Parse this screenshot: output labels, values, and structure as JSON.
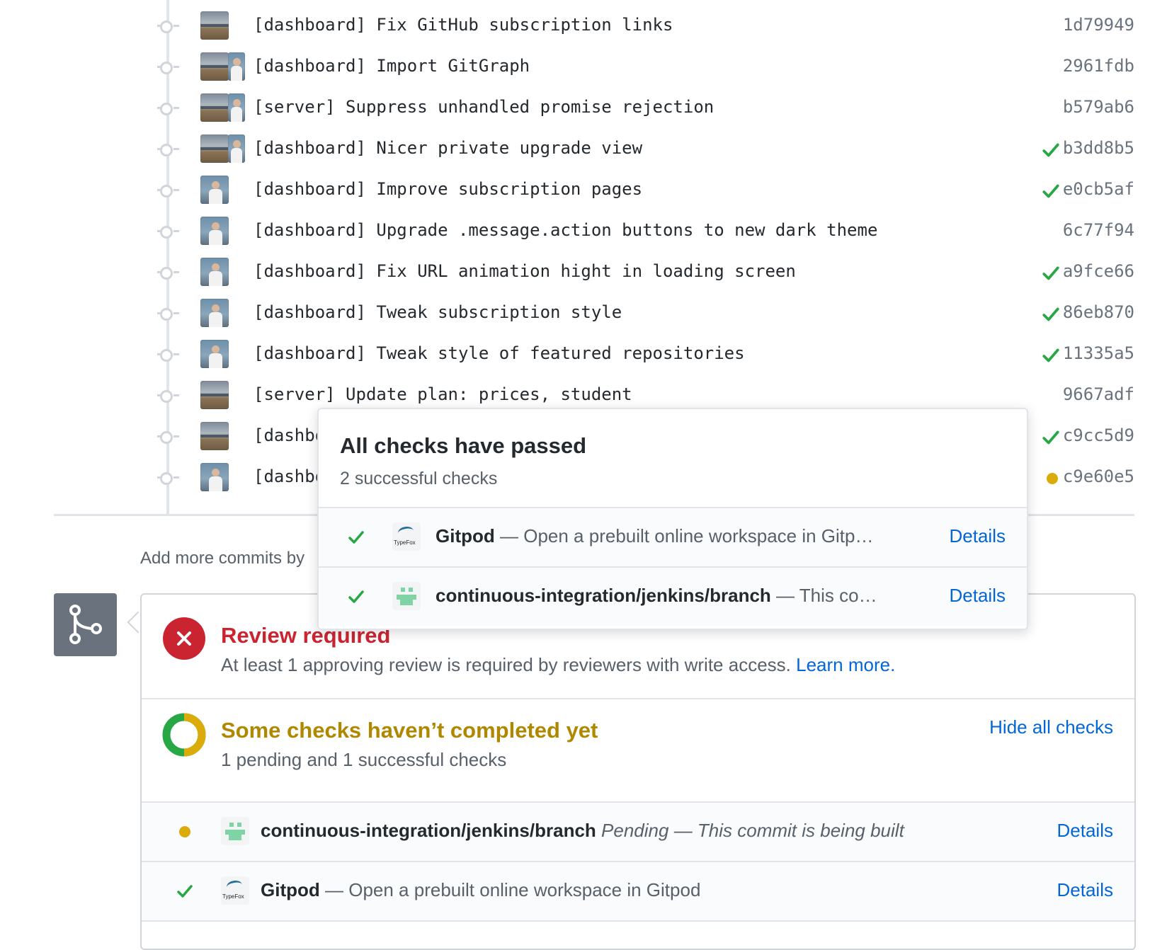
{
  "commits": [
    {
      "message": "[dashboard] Fix GitHub subscription links",
      "sha": "1d79949",
      "status": "none",
      "avatars": [
        "landscape"
      ]
    },
    {
      "message": "[dashboard] Import GitGraph",
      "sha": "2961fdb",
      "status": "none",
      "avatars": [
        "landscape",
        "person"
      ]
    },
    {
      "message": "[server] Suppress unhandled promise rejection",
      "sha": "b579ab6",
      "status": "none",
      "avatars": [
        "landscape",
        "person"
      ]
    },
    {
      "message": "[dashboard] Nicer private upgrade view",
      "sha": "b3dd8b5",
      "status": "success",
      "avatars": [
        "landscape",
        "person"
      ]
    },
    {
      "message": "[dashboard] Improve subscription pages",
      "sha": "e0cb5af",
      "status": "success",
      "avatars": [
        "person"
      ]
    },
    {
      "message": "[dashboard] Upgrade .message.action buttons to new dark theme",
      "sha": "6c77f94",
      "status": "none",
      "avatars": [
        "person"
      ]
    },
    {
      "message": "[dashboard] Fix URL animation hight in loading screen",
      "sha": "a9fce66",
      "status": "success",
      "avatars": [
        "person"
      ]
    },
    {
      "message": "[dashboard] Tweak subscription style",
      "sha": "86eb870",
      "status": "success",
      "avatars": [
        "person"
      ]
    },
    {
      "message": "[dashboard] Tweak style of featured repositories",
      "sha": "11335a5",
      "status": "success",
      "avatars": [
        "person"
      ]
    },
    {
      "message": "[server] Update plan: prices, student",
      "sha": "9667adf",
      "status": "none",
      "avatars": [
        "landscape"
      ]
    },
    {
      "message": "[dashbo",
      "sha": "c9cc5d9",
      "status": "success",
      "avatars": [
        "landscape"
      ]
    },
    {
      "message": "[dashbo",
      "sha": "c9e60e5",
      "status": "pending",
      "avatars": [
        "person"
      ]
    }
  ],
  "add_more_text": "Add more commits by",
  "merge_box": {
    "review": {
      "title": "Review required",
      "description": "At least 1 approving review is required by reviewers with write access.",
      "learn_more": "Learn more."
    },
    "checks": {
      "title": "Some checks haven’t completed yet",
      "summary": "1 pending and 1 successful checks",
      "hide_all": "Hide all checks",
      "pending_fraction": 0.5
    },
    "rows": [
      {
        "status": "pending",
        "logo": "jenkins-icon",
        "name": "continuous-integration/jenkins/branch",
        "description": "Pending — This commit is being built",
        "details": "Details"
      },
      {
        "status": "success",
        "logo": "typefox-icon",
        "name": "Gitpod",
        "description": "— Open a prebuilt online workspace in Gitpod",
        "details": "Details"
      }
    ]
  },
  "popover": {
    "title": "All checks have passed",
    "subtitle": "2 successful checks",
    "rows": [
      {
        "status": "success",
        "logo": "typefox-icon",
        "name": "Gitpod",
        "description": "— Open a prebuilt online workspace in Gitp…",
        "details": "Details"
      },
      {
        "status": "success",
        "logo": "jenkins-icon",
        "name": "continuous-integration/jenkins/branch",
        "description": "— This co…",
        "details": "Details"
      }
    ]
  },
  "logo_text": {
    "typefox": "TypeFox"
  },
  "colors": {
    "success": "#28a745",
    "pending": "#dbab09",
    "error": "#cb2431",
    "link": "#0366d6",
    "pending_title": "#b08800"
  }
}
